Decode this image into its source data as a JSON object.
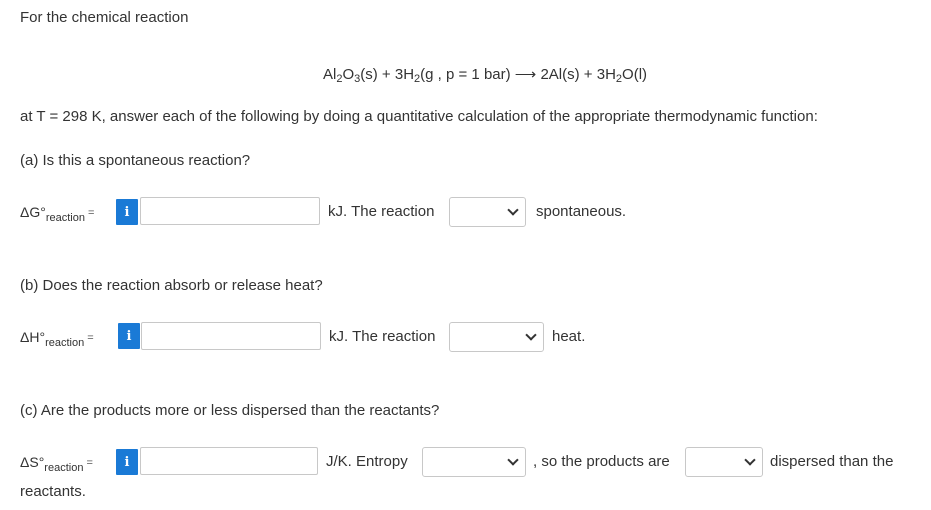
{
  "intro": "For the chemical reaction",
  "equation": {
    "al": "Al",
    "al_sub": "2",
    "o": "O",
    "o_sub": "3",
    "s1": "(s) + 3H",
    "h_sub": "2",
    "g_part": "(g , p = 1 bar) ⟶ 2Al(s) + 3H",
    "h2_sub": "2",
    "end": "O(l)"
  },
  "instruction": "at T = 298 K, answer each of the following by doing a quantitative calculation of the appropriate thermodynamic function:",
  "part_a": {
    "question": "(a) Is this a spontaneous reaction?",
    "symbol": "ΔG°",
    "subscript": "reaction",
    "equals": "=",
    "info_label": "i",
    "input_value": "",
    "unit_text": "kJ. The reaction",
    "select_value": "",
    "suffix": "spontaneous."
  },
  "part_b": {
    "question": "(b) Does the reaction absorb or release heat?",
    "symbol": "ΔH°",
    "subscript": "reaction",
    "equals": "=",
    "info_label": "i",
    "input_value": "",
    "unit_text": "kJ. The reaction",
    "select_value": "",
    "suffix": "heat."
  },
  "part_c": {
    "question": "(c) Are the products more or less dispersed than the reactants?",
    "symbol": "ΔS°",
    "subscript": "reaction",
    "equals": "=",
    "info_label": "i",
    "input_value": "",
    "unit_text": "J/K. Entropy",
    "select1_value": "",
    "middle_text": ", so the products are",
    "select2_value": "",
    "suffix": "dispersed than the",
    "continuation": "reactants."
  },
  "colors": {
    "info_button": "#1a7ad6",
    "text": "#333333",
    "border": "#c8c8c8"
  }
}
